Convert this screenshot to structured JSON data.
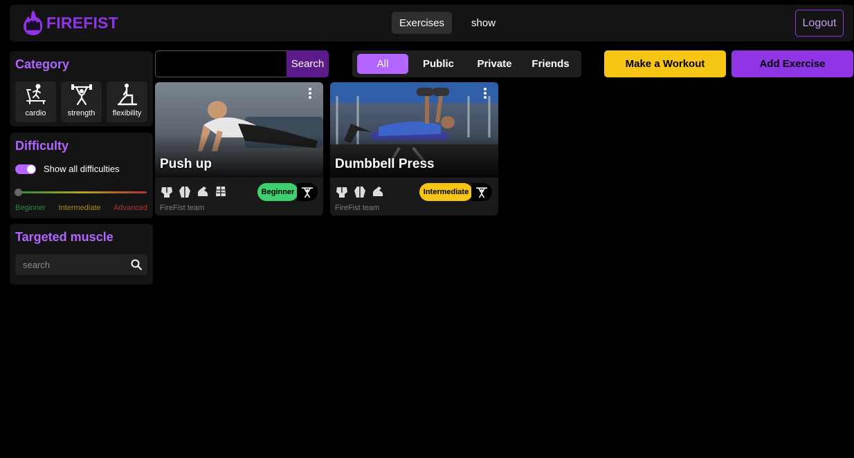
{
  "header": {
    "brand": "FIREFIST",
    "nav": [
      "Exercises",
      "show"
    ],
    "logout": "Logout"
  },
  "sidebar": {
    "category": {
      "title": "Category",
      "items": [
        {
          "label": "cardio",
          "icon": "treadmill-icon"
        },
        {
          "label": "strength",
          "icon": "weightlifter-icon"
        },
        {
          "label": "flexibility",
          "icon": "stretch-icon"
        }
      ]
    },
    "difficulty": {
      "title": "Difficulty",
      "toggle_label": "Show all difficulties",
      "toggle_on": true,
      "levels": [
        {
          "label": "Beginner",
          "color": "#2b8a3e"
        },
        {
          "label": "Intermediate",
          "color": "#a68d17"
        },
        {
          "label": "Advanced",
          "color": "#b03434"
        }
      ]
    },
    "muscle": {
      "title": "Targeted muscle",
      "placeholder": "search"
    }
  },
  "toolbar": {
    "search_button": "Search",
    "filters": [
      "All",
      "Public",
      "Private",
      "Friends"
    ],
    "active_filter": "All",
    "make_workout": "Make a Workout",
    "add_exercise": "Add Exercise"
  },
  "exercises": [
    {
      "title": "Push up",
      "difficulty": "Beginner",
      "difficulty_color": "#3ecf6e",
      "author": "FireFist team",
      "category_icon": "weightlifter-icon",
      "muscle_icons": [
        "chest-icon",
        "back-icon",
        "arm-icon",
        "abs-icon"
      ]
    },
    {
      "title": "Dumbbell Press",
      "difficulty": "Intermediate",
      "difficulty_color": "#f7c516",
      "author": "FireFist team",
      "category_icon": "weightlifter-icon",
      "muscle_icons": [
        "chest-icon",
        "back-icon",
        "arm-icon"
      ]
    }
  ],
  "colors": {
    "brand_purple": "#8f35e6",
    "accent_purple": "#b366ff",
    "yellow": "#f7c516",
    "panel": "#141414"
  }
}
